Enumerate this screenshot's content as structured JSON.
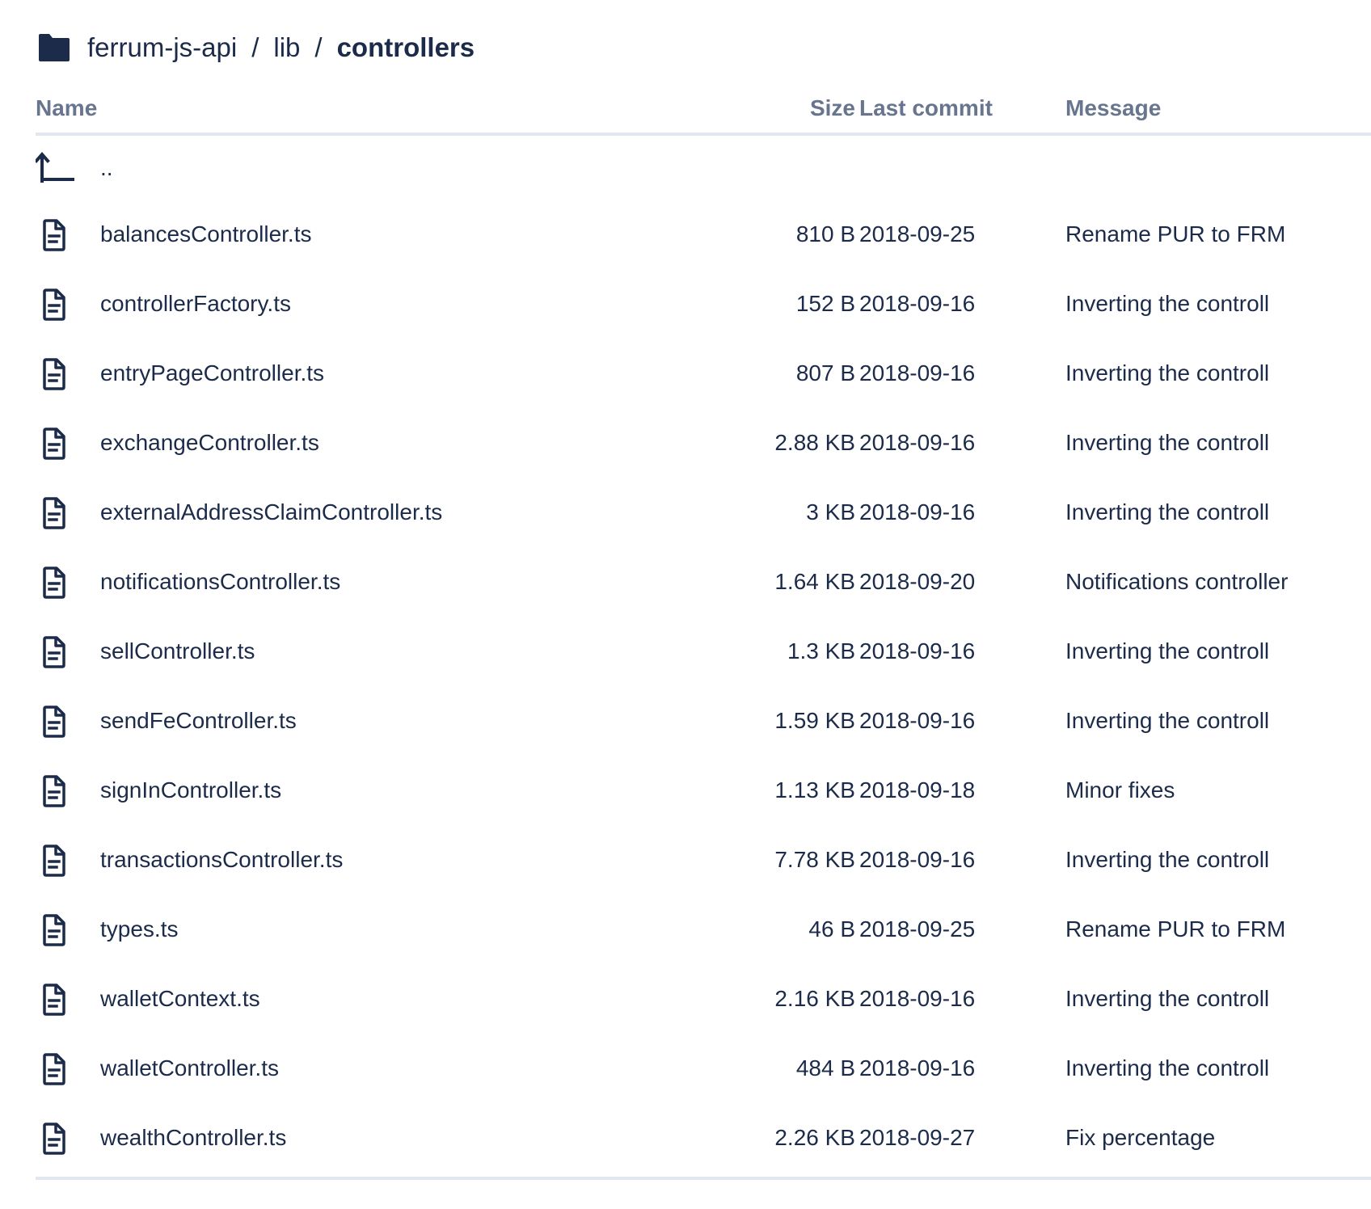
{
  "breadcrumb": {
    "icon": "folder-icon",
    "items": [
      "ferrum-js-api",
      "lib"
    ],
    "current": "controllers",
    "separator": "/"
  },
  "table": {
    "headers": {
      "name": "Name",
      "size": "Size",
      "last_commit": "Last commit",
      "message": "Message"
    },
    "parent_row": {
      "icon": "level-up-icon",
      "label": ".."
    },
    "rows": [
      {
        "name": "balancesController.ts",
        "size": "810 B",
        "last_commit": "2018-09-25",
        "message": "Rename PUR to FRM"
      },
      {
        "name": "controllerFactory.ts",
        "size": "152 B",
        "last_commit": "2018-09-16",
        "message": "Inverting the controll"
      },
      {
        "name": "entryPageController.ts",
        "size": "807 B",
        "last_commit": "2018-09-16",
        "message": "Inverting the controll"
      },
      {
        "name": "exchangeController.ts",
        "size": "2.88 KB",
        "last_commit": "2018-09-16",
        "message": "Inverting the controll"
      },
      {
        "name": "externalAddressClaimController.ts",
        "size": "3 KB",
        "last_commit": "2018-09-16",
        "message": "Inverting the controll"
      },
      {
        "name": "notificationsController.ts",
        "size": "1.64 KB",
        "last_commit": "2018-09-20",
        "message": "Notifications controller"
      },
      {
        "name": "sellController.ts",
        "size": "1.3 KB",
        "last_commit": "2018-09-16",
        "message": "Inverting the controll"
      },
      {
        "name": "sendFeController.ts",
        "size": "1.59 KB",
        "last_commit": "2018-09-16",
        "message": "Inverting the controll"
      },
      {
        "name": "signInController.ts",
        "size": "1.13 KB",
        "last_commit": "2018-09-18",
        "message": "Minor fixes"
      },
      {
        "name": "transactionsController.ts",
        "size": "7.78 KB",
        "last_commit": "2018-09-16",
        "message": "Inverting the controll"
      },
      {
        "name": "types.ts",
        "size": "46 B",
        "last_commit": "2018-09-25",
        "message": "Rename PUR to FRM"
      },
      {
        "name": "walletContext.ts",
        "size": "2.16 KB",
        "last_commit": "2018-09-16",
        "message": "Inverting the controll"
      },
      {
        "name": "walletController.ts",
        "size": "484 B",
        "last_commit": "2018-09-16",
        "message": "Inverting the controll"
      },
      {
        "name": "wealthController.ts",
        "size": "2.26 KB",
        "last_commit": "2018-09-27",
        "message": "Fix percentage"
      }
    ],
    "row_icon": "file-text-icon"
  },
  "colors": {
    "text": "#1c2b4a",
    "header_text": "#67758f",
    "rule": "#e2e6ee",
    "icon": "#1c2b4a"
  }
}
